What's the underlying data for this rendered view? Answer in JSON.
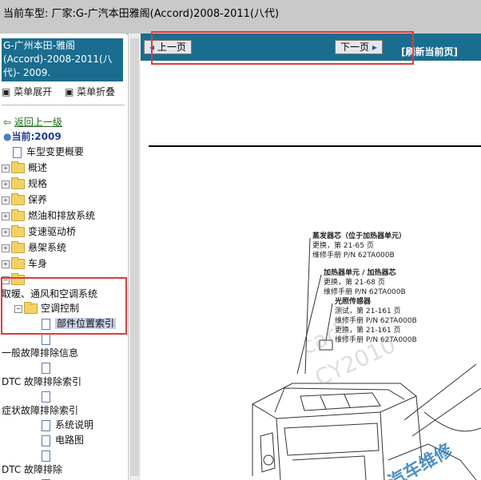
{
  "header": {
    "title": "当前车型:   厂家:G-广汽本田雅阁(Accord)2008-2011(八代)"
  },
  "left": {
    "vehicle_box": "G-广州本田-雅阁(Accord)-2008-2011(八代)- 2009.",
    "expand": "菜单展开",
    "collapse": "菜单折叠",
    "back": "返回上一级",
    "current": "当前:2009",
    "tree": [
      {
        "label": "车型变更概要"
      },
      {
        "label": "概述"
      },
      {
        "label": "规格"
      },
      {
        "label": "保养"
      },
      {
        "label": "燃油和排放系统"
      },
      {
        "label": "变速驱动桥"
      },
      {
        "label": "悬架系统"
      },
      {
        "label": "车身"
      },
      {
        "label": "取暖、通风和空调系统"
      },
      {
        "label": "空调控制"
      },
      {
        "label": "部件位置索引"
      },
      {
        "label": "一般故障排除信息"
      },
      {
        "label": "DTC 故障排除索引"
      },
      {
        "label": "症状故障排除索引"
      },
      {
        "label": "系统说明"
      },
      {
        "label": "电路图"
      },
      {
        "label": "DTC 故障排除"
      }
    ]
  },
  "nav": {
    "prev": "上一页",
    "next": "下一页",
    "refresh": "[刷新当前页]"
  },
  "diagram": {
    "c1": [
      "蒸发器芯（位于加热器单元）",
      "更换，第 21-65 页",
      "维修手册 P/N 62TA000B"
    ],
    "c2": [
      "加热器单元 / 加热器芯",
      "更换，第 21-68 页",
      "维修手册 P/N 62TA000B"
    ],
    "c3": [
      "光照传感器",
      "测试，第 21-161 页",
      "维修手册 P/N 62TA000B",
      "更换，第 21-161 页",
      "维修手册 P/N 62TA000B"
    ],
    "watermarks": [
      "car3",
      "CY2010"
    ]
  },
  "colors": {
    "panel_blue": "#1a6d8f",
    "highlight_red": "#e03a3a",
    "titlebar": "#c9c9c9"
  }
}
